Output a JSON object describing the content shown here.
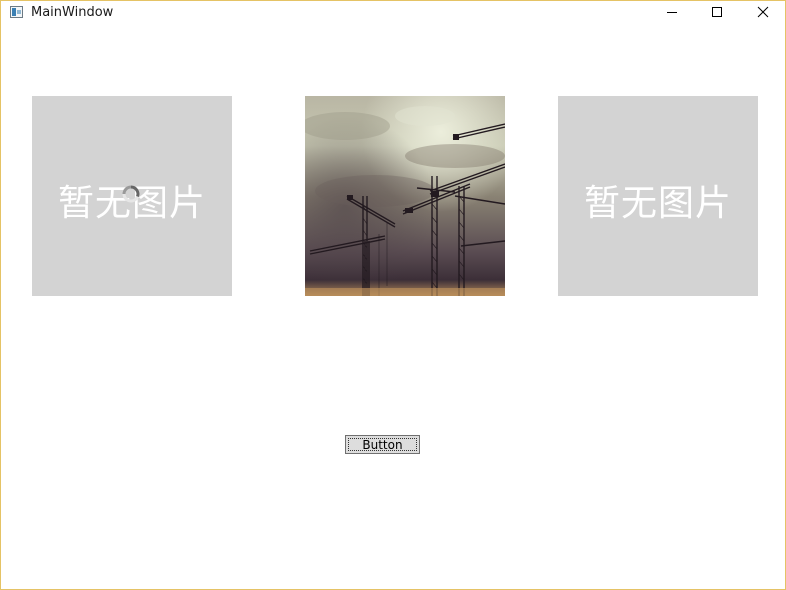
{
  "window": {
    "title": "MainWindow",
    "frame_color": "#e5c365"
  },
  "controls": {
    "minimize_icon": "minimize-icon",
    "maximize_icon": "maximize-icon",
    "close_icon": "close-icon"
  },
  "images": [
    {
      "state": "loading",
      "label": "暂无图片",
      "background": "#d3d3d3"
    },
    {
      "state": "loaded",
      "content": "construction cranes against cloudy sky"
    },
    {
      "state": "empty",
      "label": "暂无图片",
      "background": "#d3d3d3"
    }
  ],
  "button": {
    "label": "Button"
  }
}
